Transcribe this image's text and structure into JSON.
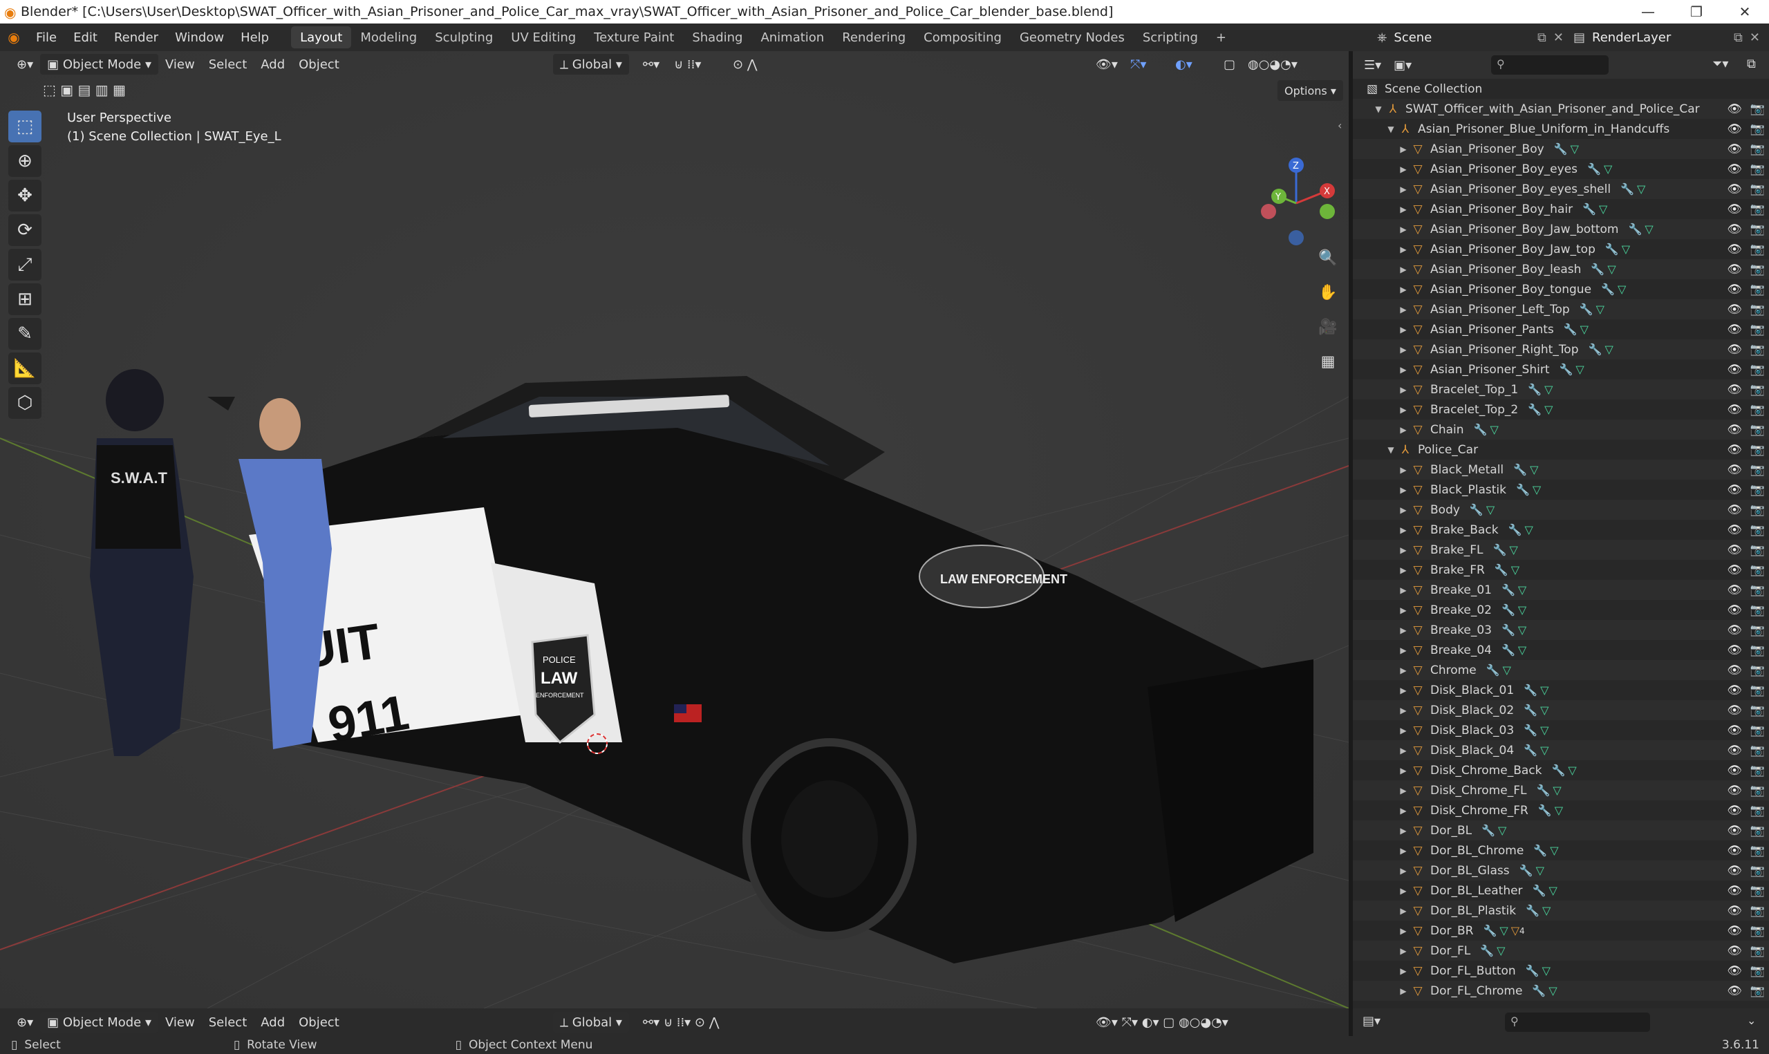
{
  "titlebar": {
    "title": "Blender* [C:\\Users\\User\\Desktop\\SWAT_Officer_with_Asian_Prisoner_and_Police_Car_max_vray\\SWAT_Officer_with_Asian_Prisoner_and_Police_Car_blender_base.blend]",
    "minimize": "—",
    "maximize": "❐",
    "close": "✕"
  },
  "menu": [
    "File",
    "Edit",
    "Render",
    "Window",
    "Help"
  ],
  "workspaces": [
    "Layout",
    "Modeling",
    "Sculpting",
    "UV Editing",
    "Texture Paint",
    "Shading",
    "Animation",
    "Rendering",
    "Compositing",
    "Geometry Nodes",
    "Scripting",
    "+"
  ],
  "scene": {
    "label": "Scene",
    "render_layer": "RenderLayer"
  },
  "viewport": {
    "mode": "Object Mode",
    "menus": [
      "View",
      "Select",
      "Add",
      "Object"
    ],
    "transform": "Global",
    "options": "Options",
    "perspective": "User Perspective",
    "collection_info": "(1) Scene Collection | SWAT_Eye_L",
    "gizmo": {
      "z": "Z",
      "y": "Y",
      "x": "X"
    },
    "scene_text": {
      "door_top": "SUIT",
      "door_num": "911",
      "badge_top": "POLICE",
      "badge_mid": "LAW",
      "badge_bot": "ENFORCEMENT",
      "vest": "S.W.A.T",
      "hood": "LAW ENFORCEMENT"
    }
  },
  "bottom_header": {
    "mode": "Object Mode",
    "menus": [
      "View",
      "Select",
      "Add",
      "Object"
    ],
    "transform": "Global"
  },
  "outliner": {
    "root": "Scene Collection",
    "rows": [
      {
        "level": 1,
        "type": "empty",
        "name": "SWAT_Officer_with_Asian_Prisoner_and_Police_Car",
        "open": true
      },
      {
        "level": 2,
        "type": "empty",
        "name": "Asian_Prisoner_Blue_Uniform_in_Handcuffs",
        "open": true
      },
      {
        "level": 3,
        "type": "mesh",
        "name": "Asian_Prisoner_Boy"
      },
      {
        "level": 3,
        "type": "mesh",
        "name": "Asian_Prisoner_Boy_eyes"
      },
      {
        "level": 3,
        "type": "mesh",
        "name": "Asian_Prisoner_Boy_eyes_shell"
      },
      {
        "level": 3,
        "type": "mesh",
        "name": "Asian_Prisoner_Boy_hair"
      },
      {
        "level": 3,
        "type": "mesh",
        "name": "Asian_Prisoner_Boy_Jaw_bottom"
      },
      {
        "level": 3,
        "type": "mesh",
        "name": "Asian_Prisoner_Boy_Jaw_top"
      },
      {
        "level": 3,
        "type": "mesh",
        "name": "Asian_Prisoner_Boy_leash"
      },
      {
        "level": 3,
        "type": "mesh",
        "name": "Asian_Prisoner_Boy_tongue"
      },
      {
        "level": 3,
        "type": "mesh",
        "name": "Asian_Prisoner_Left_Top"
      },
      {
        "level": 3,
        "type": "mesh",
        "name": "Asian_Prisoner_Pants"
      },
      {
        "level": 3,
        "type": "mesh",
        "name": "Asian_Prisoner_Right_Top"
      },
      {
        "level": 3,
        "type": "mesh",
        "name": "Asian_Prisoner_Shirt"
      },
      {
        "level": 3,
        "type": "mesh",
        "name": "Bracelet_Top_1"
      },
      {
        "level": 3,
        "type": "mesh",
        "name": "Bracelet_Top_2"
      },
      {
        "level": 3,
        "type": "mesh",
        "name": "Chain"
      },
      {
        "level": 2,
        "type": "empty",
        "name": "Police_Car",
        "open": true
      },
      {
        "level": 3,
        "type": "mesh",
        "name": "Black_Metall"
      },
      {
        "level": 3,
        "type": "mesh",
        "name": "Black_Plastik"
      },
      {
        "level": 3,
        "type": "mesh",
        "name": "Body"
      },
      {
        "level": 3,
        "type": "mesh",
        "name": "Brake_Back"
      },
      {
        "level": 3,
        "type": "mesh",
        "name": "Brake_FL"
      },
      {
        "level": 3,
        "type": "mesh",
        "name": "Brake_FR"
      },
      {
        "level": 3,
        "type": "mesh",
        "name": "Breake_01"
      },
      {
        "level": 3,
        "type": "mesh",
        "name": "Breake_02"
      },
      {
        "level": 3,
        "type": "mesh",
        "name": "Breake_03"
      },
      {
        "level": 3,
        "type": "mesh",
        "name": "Breake_04"
      },
      {
        "level": 3,
        "type": "mesh",
        "name": "Chrome"
      },
      {
        "level": 3,
        "type": "mesh",
        "name": "Disk_Black_01"
      },
      {
        "level": 3,
        "type": "mesh",
        "name": "Disk_Black_02"
      },
      {
        "level": 3,
        "type": "mesh",
        "name": "Disk_Black_03"
      },
      {
        "level": 3,
        "type": "mesh",
        "name": "Disk_Black_04"
      },
      {
        "level": 3,
        "type": "mesh",
        "name": "Disk_Chrome_Back"
      },
      {
        "level": 3,
        "type": "mesh",
        "name": "Disk_Chrome_FL"
      },
      {
        "level": 3,
        "type": "mesh",
        "name": "Disk_Chrome_FR"
      },
      {
        "level": 3,
        "type": "mesh",
        "name": "Dor_BL"
      },
      {
        "level": 3,
        "type": "mesh",
        "name": "Dor_BL_Chrome"
      },
      {
        "level": 3,
        "type": "mesh",
        "name": "Dor_BL_Glass"
      },
      {
        "level": 3,
        "type": "mesh",
        "name": "Dor_BL_Leather"
      },
      {
        "level": 3,
        "type": "mesh",
        "name": "Dor_BL_Plastik"
      },
      {
        "level": 3,
        "type": "mesh",
        "name": "Dor_BR",
        "badge": "4"
      },
      {
        "level": 3,
        "type": "mesh",
        "name": "Dor_FL"
      },
      {
        "level": 3,
        "type": "mesh",
        "name": "Dor_FL_Button"
      },
      {
        "level": 3,
        "type": "mesh",
        "name": "Dor_FL_Chrome"
      }
    ]
  },
  "status": {
    "select": "Select",
    "rotate": "Rotate View",
    "context": "Object Context Menu",
    "version": "3.6.11"
  },
  "colors": {
    "accent": "#4772b3",
    "mesh": "#4bd9a0",
    "modifier": "#6a8fe0",
    "empty": "#e39a3b"
  }
}
